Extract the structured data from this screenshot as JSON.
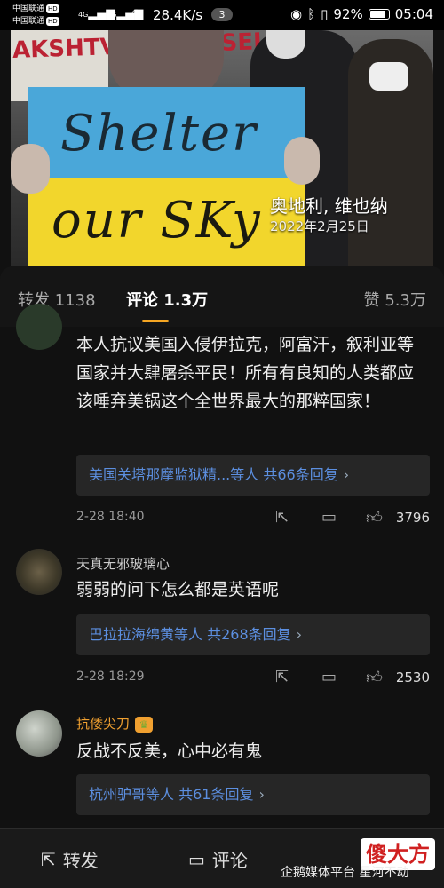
{
  "status_bar": {
    "carrier1": "中国联通",
    "carrier2": "中国联通",
    "hd": "HD",
    "net": "4G",
    "speed": "28.4K/s",
    "badge": "3",
    "battery": "92%",
    "time": "05:04"
  },
  "photo": {
    "sign_line1": "Shelter",
    "sign_line2": "our SKy",
    "back_sign": "AKSHTVM YOURSEL",
    "location": "奥地利, 维也纳",
    "date": "2022年2月25日"
  },
  "tabs": {
    "forward_label": "转发",
    "forward_count": "1138",
    "comment_label": "评论",
    "comment_count": "1.3万",
    "like_label": "赞",
    "like_count": "5.3万"
  },
  "comments": [
    {
      "text": "本人抗议美国入侵伊拉克，阿富汗，叙利亚等国家并大肆屠杀平民！所有有良知的人类都应该唾弃美锅这个全世界最大的那粹国家！",
      "reply_summary": "美国关塔那摩监狱精...等人  共66条回复",
      "time": "2-28 18:40",
      "likes": "3796"
    },
    {
      "username": "天真无邪玻璃心",
      "text": "弱弱的问下怎么都是英语呢",
      "reply_summary": "巴拉拉海绵黄等人  共268条回复",
      "time": "2-28 18:29",
      "likes": "2530"
    },
    {
      "username": "抗倭尖刀",
      "text": "反战不反美，心中必有鬼",
      "reply_summary": "杭州驴哥等人  共61条回复"
    }
  ],
  "bottom_bar": {
    "forward": "转发",
    "comment": "评论"
  },
  "watermark": {
    "source": "企鹅媒体平台 星河不动",
    "logo": "傻大方"
  },
  "icons": {
    "share": "share-icon",
    "comment": "comment-icon",
    "like": "thumbs-up-icon"
  },
  "colors": {
    "accent": "#f5a623",
    "link": "#5c8fe0",
    "vip_name": "#f0a030"
  }
}
